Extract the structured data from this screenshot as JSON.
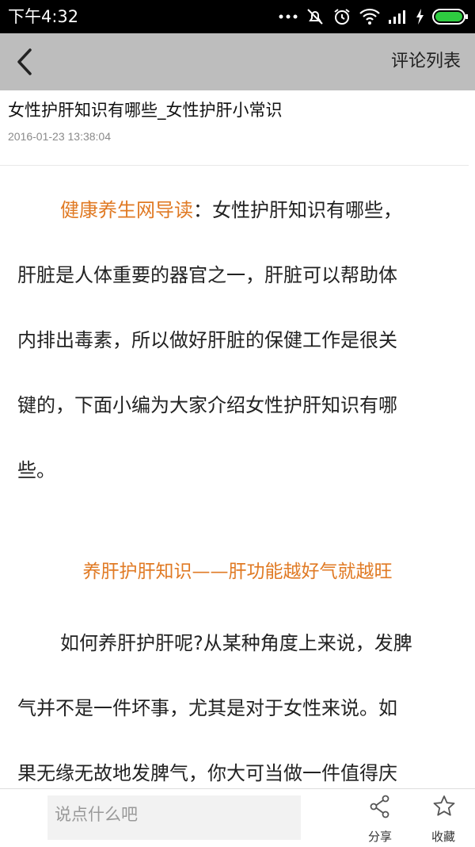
{
  "status_bar": {
    "time": "下午4:32"
  },
  "header": {
    "comment_list_label": "评论列表"
  },
  "article": {
    "title": "女性护肝知识有哪些_女性护肝小常识",
    "date": "2016-01-23  13:38:04",
    "intro_source": "健康养生网导读",
    "intro_colon": "：",
    "lines": [
      "女性护肝知识有哪些，",
      "肝脏是人体重要的器官之一，肝脏可以帮助体",
      "内排出毒素，所以做好肝脏的保健工作是很关",
      "键的，下面小编为大家介绍女性护肝知识有哪",
      "些。"
    ],
    "section_heading": "养肝护肝知识——肝功能越好气就越旺",
    "para2": [
      "如何养肝护肝呢?从某种角度上来说，发脾",
      "气并不是一件坏事，尤其是对于女性来说。如",
      "果无缘无故地发脾气，你大可当做一件值得庆"
    ]
  },
  "bottom_bar": {
    "comment_placeholder": "说点什么吧",
    "share_label": "分享",
    "collect_label": "收藏"
  }
}
